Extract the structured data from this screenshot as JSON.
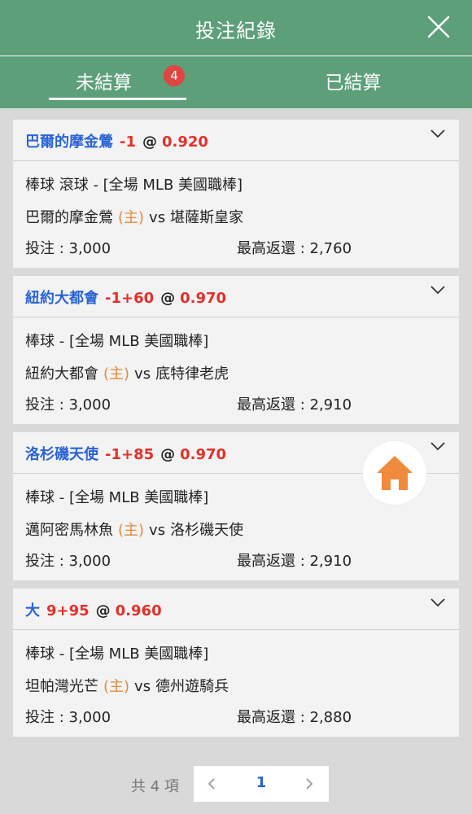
{
  "header": {
    "title": "投注紀錄"
  },
  "tabs": [
    {
      "label": "未結算",
      "badge": "4",
      "active": true
    },
    {
      "label": "已結算",
      "active": false
    }
  ],
  "bets": [
    {
      "team": "巴爾的摩金鶯",
      "handicap": "-1",
      "at": "@",
      "odds": "0.920",
      "league": "棒球 滾球 - [全場 MLB 美國職棒]",
      "home": "巴爾的摩金鶯",
      "home_tag": "(主)",
      "vs": "vs",
      "away": "堪薩斯皇家",
      "stake": "投注 : 3,000",
      "payout": "最高返還 : 2,760"
    },
    {
      "team": "紐約大都會",
      "handicap": "-1+60",
      "at": "@",
      "odds": "0.970",
      "league": "棒球 - [全場 MLB 美國職棒]",
      "home": "紐約大都會",
      "home_tag": "(主)",
      "vs": "vs",
      "away": "底特律老虎",
      "stake": "投注 : 3,000",
      "payout": "最高返還 : 2,910"
    },
    {
      "team": "洛杉磯天使",
      "handicap": "-1+85",
      "at": "@",
      "odds": "0.970",
      "league": "棒球 - [全場 MLB 美國職棒]",
      "home": "邁阿密馬林魚",
      "home_tag": "(主)",
      "vs": "vs",
      "away": "洛杉磯天使",
      "stake": "投注 : 3,000",
      "payout": "最高返還 : 2,910"
    },
    {
      "team": "大",
      "handicap": "9+95",
      "at": "@",
      "odds": "0.960",
      "league": "棒球 - [全場 MLB 美國職棒]",
      "home": "坦帕灣光芒",
      "home_tag": "(主)",
      "vs": "vs",
      "away": "德州遊騎兵",
      "stake": "投注 : 3,000",
      "payout": "最高返還 : 2,880"
    }
  ],
  "pagination": {
    "total": "共 4 項",
    "current_page": "1"
  },
  "icons": {
    "close": "close-icon",
    "chevron": "chevron-down-icon",
    "home": "home-icon",
    "prev": "chevron-left-icon",
    "next": "chevron-right-icon"
  },
  "colors": {
    "header_bg": "#5c9f79",
    "team": "#2a63d6",
    "handicap": "#e3302a",
    "home_tag": "#e38a3b",
    "badge": "#e14541",
    "home_button": "#f08a3c"
  }
}
